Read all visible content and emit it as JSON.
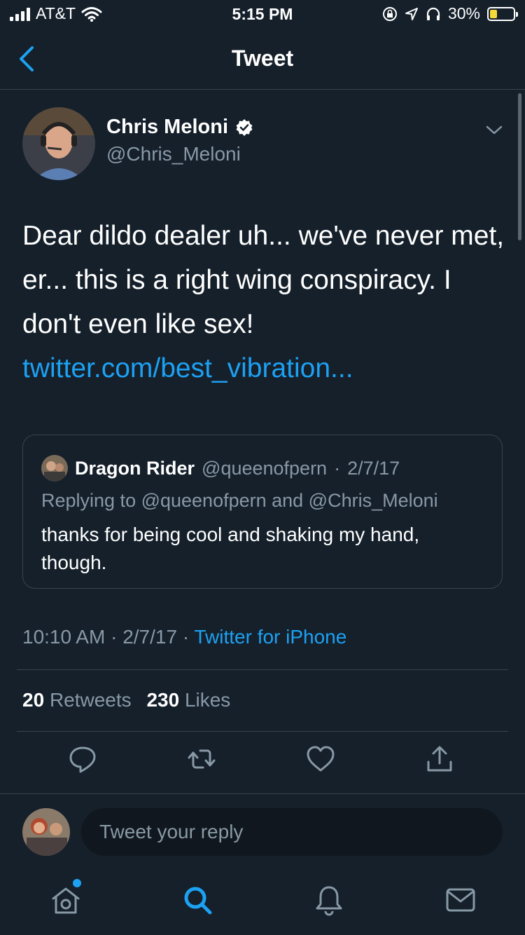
{
  "status_bar": {
    "carrier": "AT&T",
    "time": "5:15 PM",
    "battery": "30%",
    "battery_level": 0.3
  },
  "nav": {
    "title": "Tweet"
  },
  "tweet": {
    "author_name": "Chris Meloni",
    "author_handle": "@Chris_Meloni",
    "verified": true,
    "text": "Dear dildo dealer uh... we've never met, er... this is a right wing conspiracy. I don't even like sex!",
    "link": "twitter.com/best_vibration..."
  },
  "quote": {
    "name": "Dragon Rider",
    "handle": "@queenofpern",
    "separator": "·",
    "date": "2/7/17",
    "replying_to": "Replying to @queenofpern and @Chris_Meloni",
    "text": "thanks for being cool and shaking my hand, though."
  },
  "meta": {
    "time": "10:10 AM",
    "date": "2/7/17",
    "separator": "·",
    "source": "Twitter for iPhone"
  },
  "stats": {
    "retweets_count": "20",
    "retweets_label": "Retweets",
    "likes_count": "230",
    "likes_label": "Likes"
  },
  "actions": [
    "reply-icon",
    "retweet-icon",
    "like-icon",
    "share-icon"
  ],
  "reply_bar": {
    "placeholder": "Tweet your reply"
  },
  "tab_bar": [
    "home-icon",
    "search-icon",
    "notifications-icon",
    "messages-icon"
  ],
  "colors": {
    "background": "#15202b",
    "accent": "#1da1f2",
    "muted": "#8899a6",
    "border": "#38444d"
  }
}
